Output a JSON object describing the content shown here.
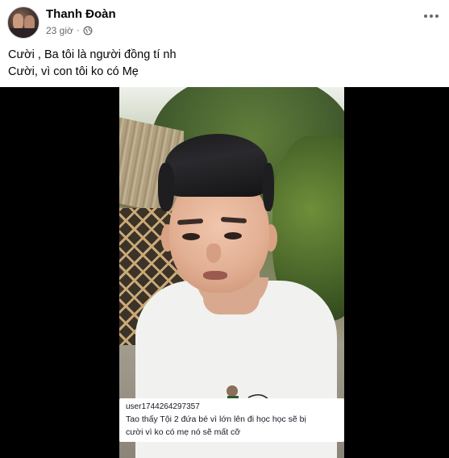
{
  "post": {
    "author": "Thanh Đoàn",
    "time": "23 giờ",
    "dot": "·",
    "caption_lines": [
      "Cười , Ba tôi là người đồng tí nh",
      "Cười, vì con tôi ko có Mẹ"
    ],
    "icons": {
      "privacy": "globe-icon",
      "more": "more-options-icon"
    }
  },
  "video": {
    "comment": {
      "user": "user1744264297357",
      "text_lines": [
        "Tao thấy Tội 2 đứa bé vì lớn lên đi học học sẽ bị",
        "cười vì ko có mẹ nó sẽ mất cỡ"
      ]
    }
  },
  "colors": {
    "text_primary": "#050505",
    "text_secondary": "#65676b",
    "media_background": "#000000"
  }
}
